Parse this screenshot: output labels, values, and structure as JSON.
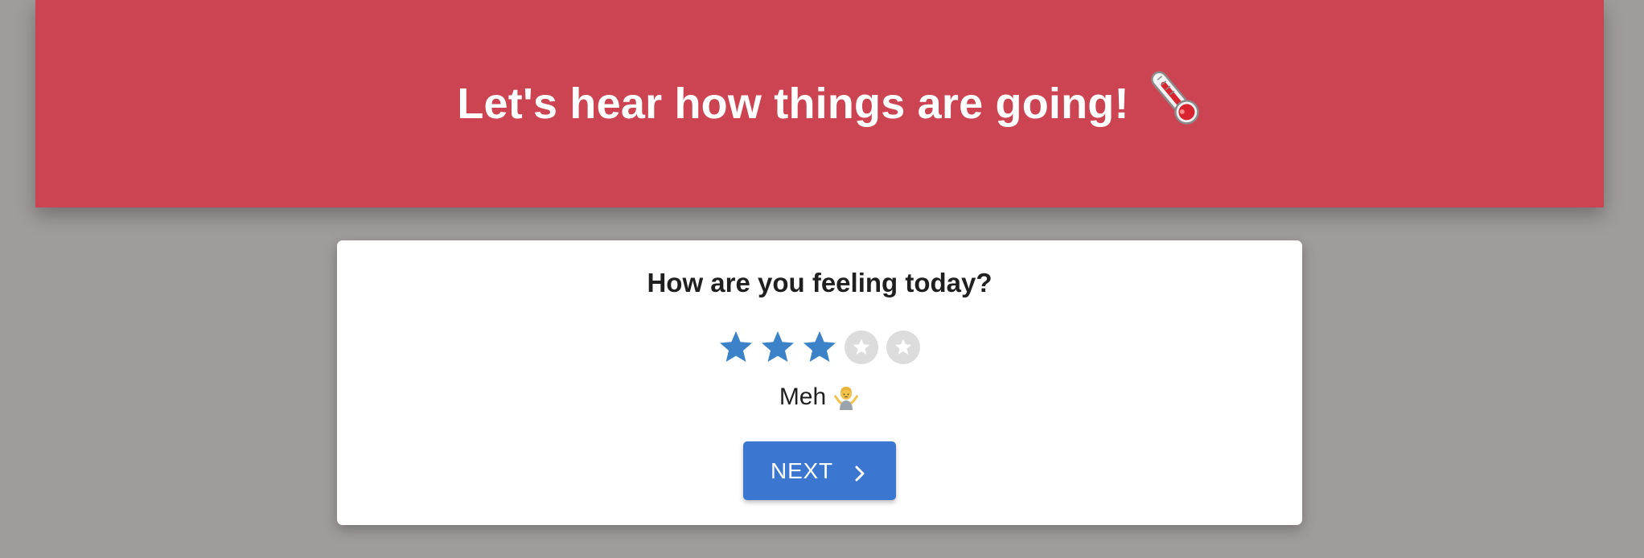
{
  "hero": {
    "title": "Let's hear how things are going!",
    "icon": "thermometer-icon",
    "background_color": "#cc4452"
  },
  "card": {
    "question": "How are you feeling today?",
    "rating": {
      "value": 3,
      "max": 5,
      "filled_color": "#3b82c9",
      "empty_color": "#dcdcdc",
      "label": "Meh",
      "label_icon": "shrug-icon"
    },
    "next_button": {
      "label": "NEXT",
      "icon": "chevron-right-icon",
      "color": "#3b77d1"
    }
  }
}
